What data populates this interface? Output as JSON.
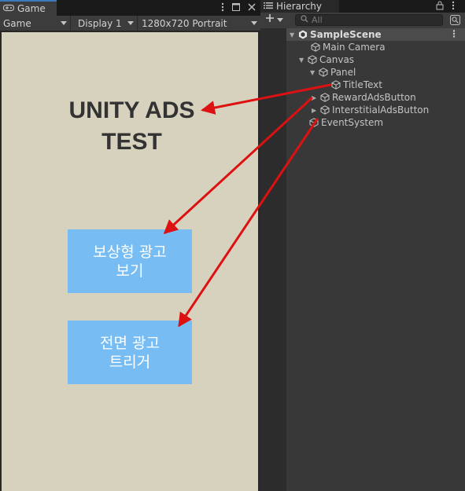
{
  "game": {
    "tab_label": "Game",
    "toolbar": {
      "mode": "Game",
      "display": "Display 1",
      "resolution": "1280x720 Portrait"
    },
    "title_line1": "UNITY ADS",
    "title_line2": "TEST",
    "reward_button_line1": "보상형 광고",
    "reward_button_line2": "보기",
    "interstitial_button_line1": "전면 광고",
    "interstitial_button_line2": "트리거"
  },
  "hierarchy": {
    "tab_label": "Hierarchy",
    "search_placeholder": "All",
    "scene": "SampleScene",
    "items": [
      {
        "label": "Main Camera"
      },
      {
        "label": "Canvas"
      },
      {
        "label": "Panel"
      },
      {
        "label": "TitleText"
      },
      {
        "label": "RewardAdsButton"
      },
      {
        "label": "InterstitialAdsButton"
      },
      {
        "label": "EventSystem"
      }
    ]
  },
  "colors": {
    "annotation_arrow": "#dd1111",
    "game_background": "#d7d2bd",
    "button_fill": "#77bdf4",
    "tab_accent": "#3a79bb"
  }
}
